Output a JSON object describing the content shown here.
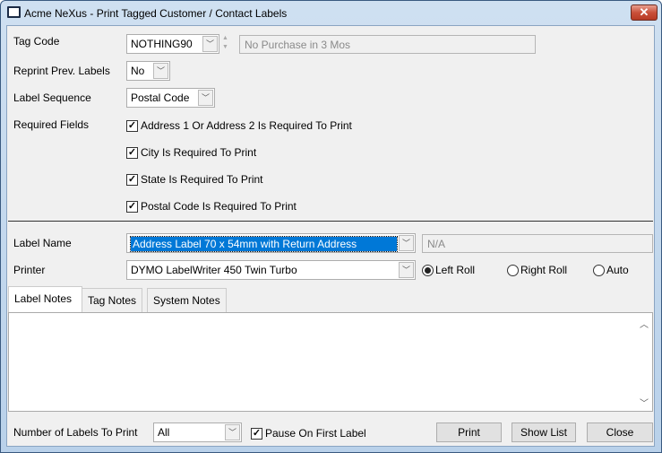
{
  "window": {
    "title": "Acme NeXus - Print Tagged Customer / Contact Labels",
    "close": "✕"
  },
  "form": {
    "tag_code": {
      "label": "Tag Code",
      "value": "NOTHING90",
      "description": "No Purchase in 3 Mos"
    },
    "reprint": {
      "label": "Reprint Prev. Labels",
      "value": "No"
    },
    "sequence": {
      "label": "Label Sequence",
      "value": "Postal Code"
    },
    "required": {
      "label": "Required Fields",
      "items": [
        {
          "label": "Address 1 Or Address 2 Is Required To Print",
          "checked": true
        },
        {
          "label": "City Is Required To Print",
          "checked": true
        },
        {
          "label": "State Is Required To Print",
          "checked": true
        },
        {
          "label": "Postal Code Is Required To Print",
          "checked": true
        }
      ]
    },
    "label_name": {
      "label": "Label Name",
      "value": "Address Label 70 x 54mm with Return Address",
      "extra": "N/A"
    },
    "printer": {
      "label": "Printer",
      "value": "DYMO LabelWriter 450 Twin Turbo",
      "rolls": [
        {
          "label": "Left Roll",
          "selected": true
        },
        {
          "label": "Right Roll",
          "selected": false
        },
        {
          "label": "Auto",
          "selected": false
        }
      ]
    }
  },
  "tabs": [
    {
      "label": "Label Notes",
      "active": true
    },
    {
      "label": "Tag Notes"
    },
    {
      "label": "System Notes"
    }
  ],
  "notes": "",
  "footer": {
    "count_label": "Number of Labels To Print",
    "count_value": "All",
    "pause": {
      "label": "Pause On First Label",
      "checked": true
    },
    "buttons": {
      "print": "Print",
      "show_list": "Show List",
      "close": "Close"
    }
  },
  "colors": {
    "selection": "#0078d7",
    "titlebar": "#b9d1ea",
    "close": "#c9503a"
  }
}
